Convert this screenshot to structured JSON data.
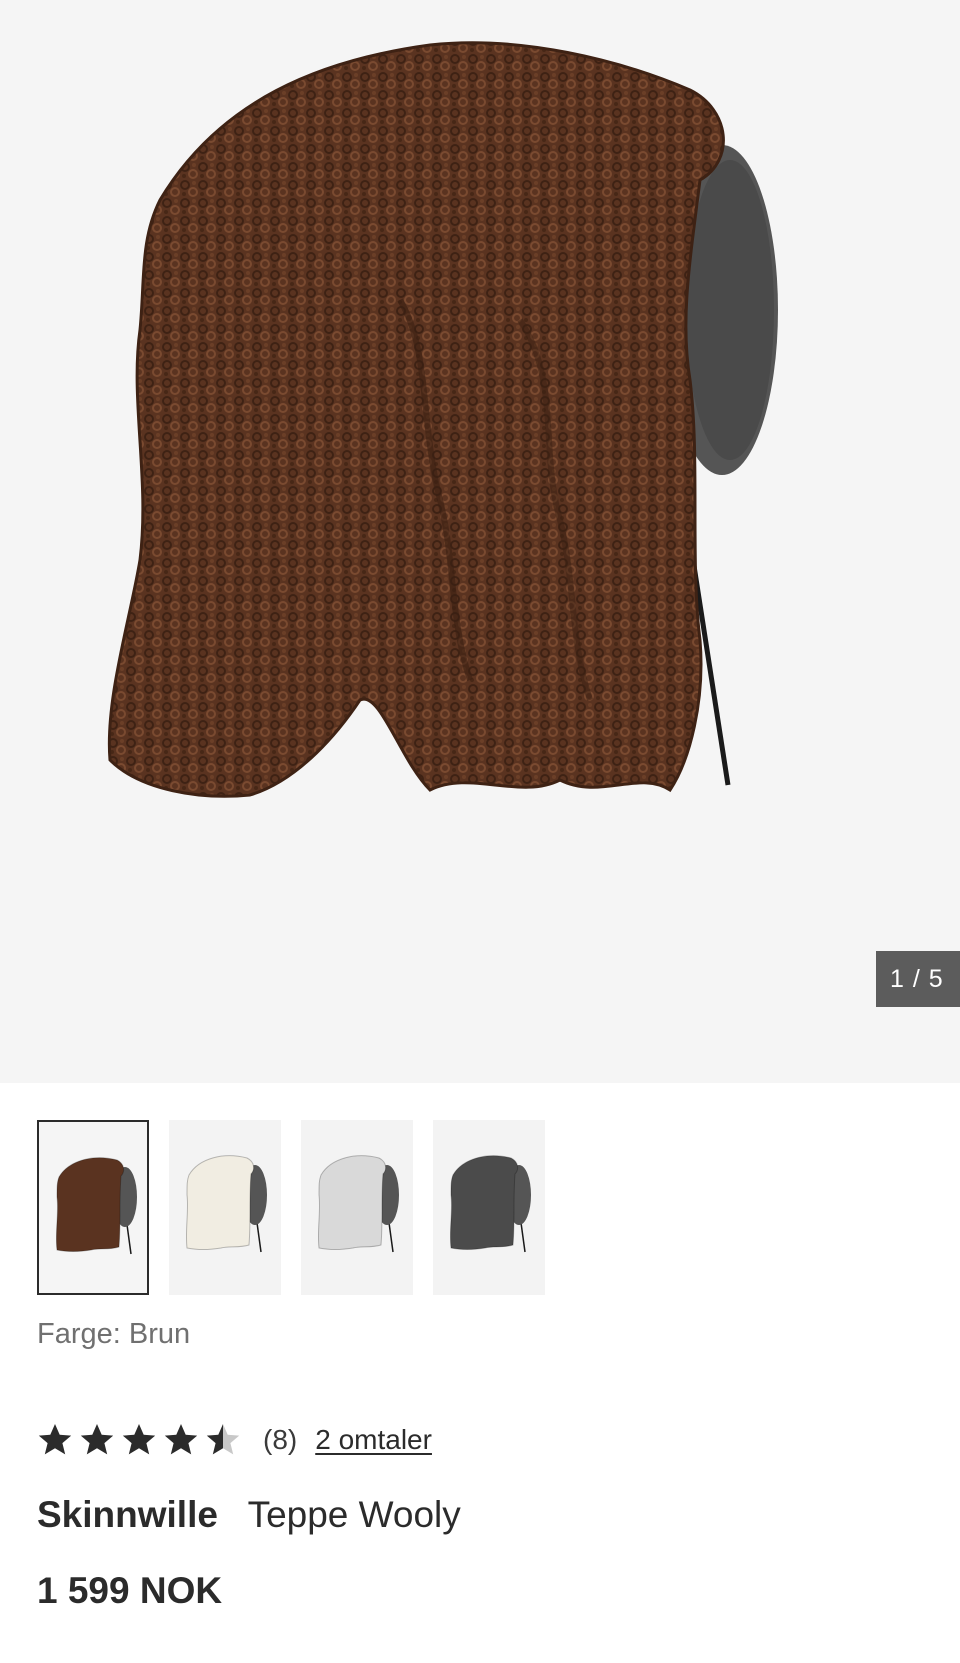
{
  "gallery": {
    "counter": "1 / 5",
    "main_image_icon": "brown-wool-throw-on-chair-image",
    "thumbnails": [
      {
        "color_name": "Brun",
        "fur": "#5a3320",
        "selected": true
      },
      {
        "color_name": "Hvit",
        "fur": "#f1ede2",
        "selected": false
      },
      {
        "color_name": "Lysegrå",
        "fur": "#d9d9d9",
        "selected": false
      },
      {
        "color_name": "Grå",
        "fur": "#4b4b4b",
        "selected": false
      }
    ]
  },
  "color": {
    "label": "Farge:",
    "value": "Brun"
  },
  "rating": {
    "stars": 4.5,
    "max": 5,
    "count_text": "(8)",
    "reviews_link": "2 omtaler"
  },
  "product": {
    "brand": "Skinnwille",
    "name": "Teppe Wooly",
    "price": "1 599 NOK"
  },
  "colors": {
    "image_bg": "#f5f5f5",
    "counter_bg": "#5c5c5c",
    "text": "#2b2b2b",
    "muted_text": "#707070",
    "star": "#2b2b2b",
    "star_empty": "#c8c8c8"
  }
}
